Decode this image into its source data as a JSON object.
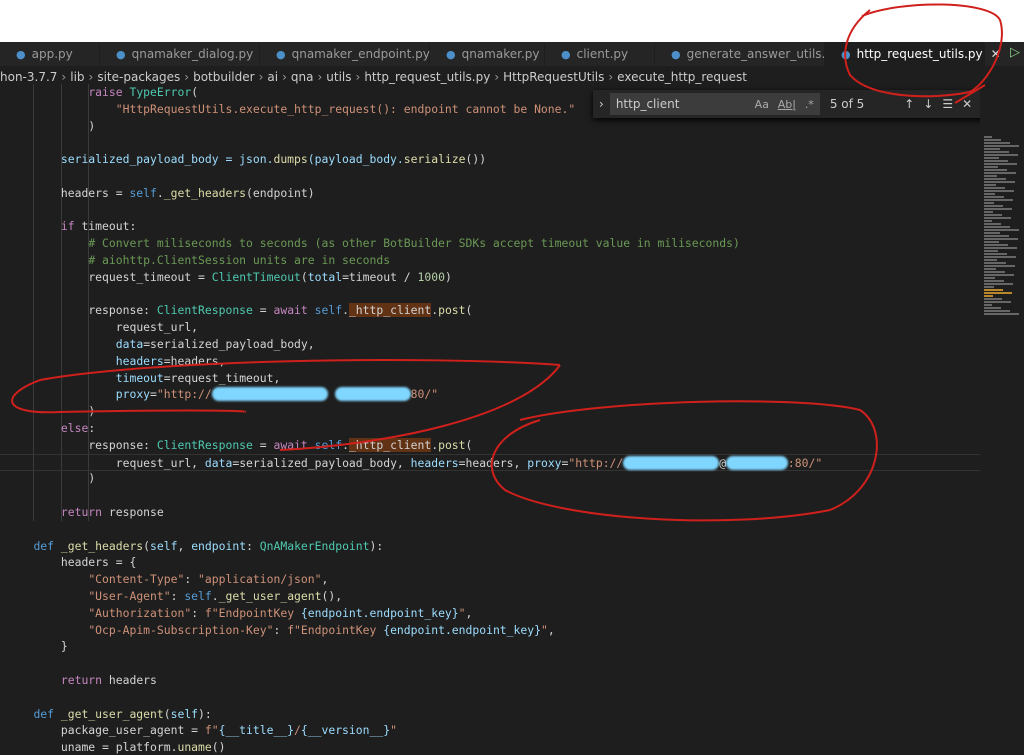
{
  "tabs": [
    {
      "label": "app.py"
    },
    {
      "label": "qnamaker_dialog.py"
    },
    {
      "label": "qnamaker_endpoint.py"
    },
    {
      "label": "qnamaker.py"
    },
    {
      "label": "client.py"
    },
    {
      "label": "generate_answer_utils.py"
    },
    {
      "label": "http_request_utils.py",
      "active": true
    }
  ],
  "tab_close": "✕",
  "run_icon": "▷",
  "breadcrumb": [
    "hon-3.7.7",
    "lib",
    "site-packages",
    "botbuilder",
    "ai",
    "qna",
    "utils",
    "http_request_utils.py",
    "HttpRequestUtils",
    "execute_http_request"
  ],
  "find": {
    "query": "http_client",
    "match_case": "Aa",
    "whole_word": "Ab|",
    "regex": ".*",
    "count": "5 of 5",
    "prev": "↑",
    "next": "↓",
    "selection": "☰",
    "close": "✕",
    "toggle": "›"
  },
  "annotation_color": "#d0201c",
  "code": [
    {
      "i": 3,
      "t": [
        [
          "raise ",
          "ctl"
        ],
        [
          "TypeError",
          "cls"
        ],
        [
          "(",
          ""
        ]
      ]
    },
    {
      "i": 4,
      "t": [
        [
          "\"HttpRequestUtils.execute_http_request(): endpoint cannot be None.\"",
          "str"
        ]
      ]
    },
    {
      "i": 3,
      "t": [
        [
          ")",
          ""
        ]
      ]
    },
    {
      "i": 0,
      "t": []
    },
    {
      "i": 2,
      "t": [
        [
          "serialized_payload_body = json.",
          "prm"
        ],
        [
          "dumps",
          "fn"
        ],
        [
          "(payload_body.",
          "prm"
        ],
        [
          "serialize",
          "fn"
        ],
        [
          "())",
          ""
        ]
      ]
    },
    {
      "i": 0,
      "t": []
    },
    {
      "i": 2,
      "t": [
        [
          "headers = ",
          ""
        ],
        [
          "self",
          "kw"
        ],
        [
          ".",
          ""
        ],
        [
          "_get_headers",
          "fn"
        ],
        [
          "(endpoint)",
          ""
        ]
      ]
    },
    {
      "i": 0,
      "t": []
    },
    {
      "i": 2,
      "t": [
        [
          "if ",
          "ctl"
        ],
        [
          "timeout:",
          ""
        ]
      ]
    },
    {
      "i": 3,
      "t": [
        [
          "# Convert miliseconds to seconds (as other BotBuilder SDKs accept timeout value in miliseconds)",
          "cm"
        ]
      ]
    },
    {
      "i": 3,
      "t": [
        [
          "# aiohttp.ClientSession units are in seconds",
          "cm"
        ]
      ]
    },
    {
      "i": 3,
      "t": [
        [
          "request_timeout = ",
          ""
        ],
        [
          "ClientTimeout",
          "cls"
        ],
        [
          "(",
          ""
        ],
        [
          "total",
          "prm"
        ],
        [
          "=timeout / ",
          ""
        ],
        [
          "1000",
          "num"
        ],
        [
          ")",
          ""
        ]
      ]
    },
    {
      "i": 0,
      "t": []
    },
    {
      "i": 3,
      "t": [
        [
          "response: ",
          ""
        ],
        [
          "ClientResponse",
          "cls"
        ],
        [
          " = ",
          ""
        ],
        [
          "await ",
          "ctl"
        ],
        [
          "self",
          "kw"
        ],
        [
          ".",
          ""
        ],
        [
          "_http_client",
          "hl"
        ],
        [
          ".",
          ""
        ],
        [
          "post",
          "fn"
        ],
        [
          "(",
          ""
        ]
      ]
    },
    {
      "i": 4,
      "t": [
        [
          "request_url,",
          ""
        ]
      ]
    },
    {
      "i": 4,
      "t": [
        [
          "data",
          "prm"
        ],
        [
          "=serialized_payload_body,",
          ""
        ]
      ]
    },
    {
      "i": 4,
      "t": [
        [
          "headers",
          "prm"
        ],
        [
          "=headers,",
          ""
        ]
      ]
    },
    {
      "i": 4,
      "t": [
        [
          "timeout",
          "prm"
        ],
        [
          "=request_timeout,",
          ""
        ]
      ]
    },
    {
      "i": 4,
      "t": [
        [
          "proxy",
          "prm"
        ],
        [
          "=",
          ""
        ],
        [
          "\"http://",
          "str"
        ],
        [
          "xxxxxxxxxxxxxxxxx",
          "blur"
        ],
        [
          " ",
          ""
        ],
        [
          "xxxxxxxxxxx",
          "blur"
        ],
        [
          "80/\"",
          "str"
        ]
      ]
    },
    {
      "i": 3,
      "t": [
        [
          ")",
          ""
        ]
      ]
    },
    {
      "i": 2,
      "t": [
        [
          "else",
          "ctl"
        ],
        [
          ":",
          ""
        ]
      ]
    },
    {
      "i": 3,
      "t": [
        [
          "response: ",
          ""
        ],
        [
          "ClientResponse",
          "cls"
        ],
        [
          " = ",
          ""
        ],
        [
          "await ",
          "ctl"
        ],
        [
          "self",
          "kw"
        ],
        [
          ".",
          ""
        ],
        [
          "_http_client",
          "hl"
        ],
        [
          ".",
          ""
        ],
        [
          "post",
          "fn"
        ],
        [
          "(",
          ""
        ]
      ]
    },
    {
      "i": 4,
      "cur": true,
      "t": [
        [
          "request_url, ",
          ""
        ],
        [
          "data",
          "prm"
        ],
        [
          "=serialized_payload_body, ",
          ""
        ],
        [
          "headers",
          "prm"
        ],
        [
          "=headers, ",
          ""
        ],
        [
          "proxy",
          "prm"
        ],
        [
          "=",
          ""
        ],
        [
          "\"http://",
          "str"
        ],
        [
          "xxxxxxxxxxxxxx",
          "blur"
        ],
        [
          "@",
          ""
        ],
        [
          "xxxxxxxxx",
          "blur"
        ],
        [
          ":80/\"",
          "str"
        ]
      ]
    },
    {
      "i": 3,
      "t": [
        [
          ")",
          ""
        ]
      ]
    },
    {
      "i": 0,
      "t": []
    },
    {
      "i": 2,
      "t": [
        [
          "return ",
          "ctl"
        ],
        [
          "response",
          ""
        ]
      ]
    },
    {
      "i": 0,
      "t": []
    },
    {
      "i": 1,
      "t": [
        [
          "def ",
          "kw"
        ],
        [
          "_get_headers",
          "fn"
        ],
        [
          "(",
          ""
        ],
        [
          "self",
          "prm"
        ],
        [
          ", ",
          ""
        ],
        [
          "endpoint",
          "prm"
        ],
        [
          ": ",
          ""
        ],
        [
          "QnAMakerEndpoint",
          "cls"
        ],
        [
          "):",
          ""
        ]
      ]
    },
    {
      "i": 2,
      "t": [
        [
          "headers = {",
          ""
        ]
      ]
    },
    {
      "i": 3,
      "t": [
        [
          "\"Content-Type\"",
          "str"
        ],
        [
          ": ",
          ""
        ],
        [
          "\"application/json\"",
          "str"
        ],
        [
          ",",
          ""
        ]
      ]
    },
    {
      "i": 3,
      "t": [
        [
          "\"User-Agent\"",
          "str"
        ],
        [
          ": ",
          ""
        ],
        [
          "self",
          "kw"
        ],
        [
          ".",
          ""
        ],
        [
          "_get_user_agent",
          "fn"
        ],
        [
          "(),",
          ""
        ]
      ]
    },
    {
      "i": 3,
      "t": [
        [
          "\"Authorization\"",
          "str"
        ],
        [
          ": ",
          ""
        ],
        [
          "f\"EndpointKey ",
          "str"
        ],
        [
          "{endpoint.endpoint_key}",
          "prm"
        ],
        [
          "\"",
          "str"
        ],
        [
          ",",
          ""
        ]
      ]
    },
    {
      "i": 3,
      "t": [
        [
          "\"Ocp-Apim-Subscription-Key\"",
          "str"
        ],
        [
          ": ",
          ""
        ],
        [
          "f\"EndpointKey ",
          "str"
        ],
        [
          "{endpoint.endpoint_key}",
          "prm"
        ],
        [
          "\"",
          "str"
        ],
        [
          ",",
          ""
        ]
      ]
    },
    {
      "i": 2,
      "t": [
        [
          "}",
          ""
        ]
      ]
    },
    {
      "i": 0,
      "t": []
    },
    {
      "i": 2,
      "t": [
        [
          "return ",
          "ctl"
        ],
        [
          "headers",
          ""
        ]
      ]
    },
    {
      "i": 0,
      "t": []
    },
    {
      "i": 1,
      "t": [
        [
          "def ",
          "kw"
        ],
        [
          "_get_user_agent",
          "fn"
        ],
        [
          "(",
          ""
        ],
        [
          "self",
          "prm"
        ],
        [
          "):",
          ""
        ]
      ]
    },
    {
      "i": 2,
      "t": [
        [
          "package_user_agent = ",
          ""
        ],
        [
          "f\"",
          "str"
        ],
        [
          "{__title__}",
          "prm"
        ],
        [
          "/",
          "str"
        ],
        [
          "{__version__}",
          "prm"
        ],
        [
          "\"",
          "str"
        ]
      ]
    },
    {
      "i": 2,
      "t": [
        [
          "uname = platform.",
          ""
        ],
        [
          "uname",
          "fn"
        ],
        [
          "()",
          ""
        ]
      ]
    }
  ]
}
